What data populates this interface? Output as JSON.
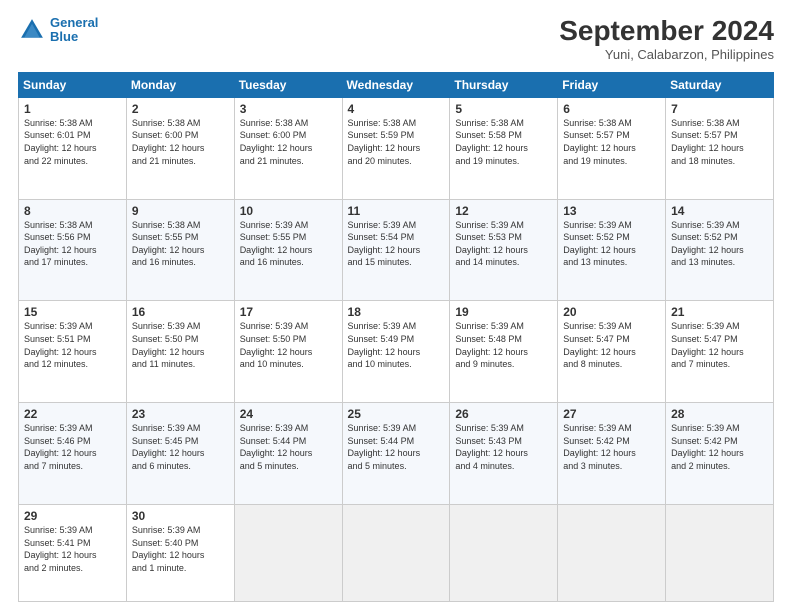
{
  "logo": {
    "line1": "General",
    "line2": "Blue"
  },
  "title": "September 2024",
  "subtitle": "Yuni, Calabarzon, Philippines",
  "header_days": [
    "Sunday",
    "Monday",
    "Tuesday",
    "Wednesday",
    "Thursday",
    "Friday",
    "Saturday"
  ],
  "weeks": [
    [
      {
        "day": "1",
        "info": "Sunrise: 5:38 AM\nSunset: 6:01 PM\nDaylight: 12 hours\nand 22 minutes."
      },
      {
        "day": "2",
        "info": "Sunrise: 5:38 AM\nSunset: 6:00 PM\nDaylight: 12 hours\nand 21 minutes."
      },
      {
        "day": "3",
        "info": "Sunrise: 5:38 AM\nSunset: 6:00 PM\nDaylight: 12 hours\nand 21 minutes."
      },
      {
        "day": "4",
        "info": "Sunrise: 5:38 AM\nSunset: 5:59 PM\nDaylight: 12 hours\nand 20 minutes."
      },
      {
        "day": "5",
        "info": "Sunrise: 5:38 AM\nSunset: 5:58 PM\nDaylight: 12 hours\nand 19 minutes."
      },
      {
        "day": "6",
        "info": "Sunrise: 5:38 AM\nSunset: 5:57 PM\nDaylight: 12 hours\nand 19 minutes."
      },
      {
        "day": "7",
        "info": "Sunrise: 5:38 AM\nSunset: 5:57 PM\nDaylight: 12 hours\nand 18 minutes."
      }
    ],
    [
      {
        "day": "8",
        "info": "Sunrise: 5:38 AM\nSunset: 5:56 PM\nDaylight: 12 hours\nand 17 minutes."
      },
      {
        "day": "9",
        "info": "Sunrise: 5:38 AM\nSunset: 5:55 PM\nDaylight: 12 hours\nand 16 minutes."
      },
      {
        "day": "10",
        "info": "Sunrise: 5:39 AM\nSunset: 5:55 PM\nDaylight: 12 hours\nand 16 minutes."
      },
      {
        "day": "11",
        "info": "Sunrise: 5:39 AM\nSunset: 5:54 PM\nDaylight: 12 hours\nand 15 minutes."
      },
      {
        "day": "12",
        "info": "Sunrise: 5:39 AM\nSunset: 5:53 PM\nDaylight: 12 hours\nand 14 minutes."
      },
      {
        "day": "13",
        "info": "Sunrise: 5:39 AM\nSunset: 5:52 PM\nDaylight: 12 hours\nand 13 minutes."
      },
      {
        "day": "14",
        "info": "Sunrise: 5:39 AM\nSunset: 5:52 PM\nDaylight: 12 hours\nand 13 minutes."
      }
    ],
    [
      {
        "day": "15",
        "info": "Sunrise: 5:39 AM\nSunset: 5:51 PM\nDaylight: 12 hours\nand 12 minutes."
      },
      {
        "day": "16",
        "info": "Sunrise: 5:39 AM\nSunset: 5:50 PM\nDaylight: 12 hours\nand 11 minutes."
      },
      {
        "day": "17",
        "info": "Sunrise: 5:39 AM\nSunset: 5:50 PM\nDaylight: 12 hours\nand 10 minutes."
      },
      {
        "day": "18",
        "info": "Sunrise: 5:39 AM\nSunset: 5:49 PM\nDaylight: 12 hours\nand 10 minutes."
      },
      {
        "day": "19",
        "info": "Sunrise: 5:39 AM\nSunset: 5:48 PM\nDaylight: 12 hours\nand 9 minutes."
      },
      {
        "day": "20",
        "info": "Sunrise: 5:39 AM\nSunset: 5:47 PM\nDaylight: 12 hours\nand 8 minutes."
      },
      {
        "day": "21",
        "info": "Sunrise: 5:39 AM\nSunset: 5:47 PM\nDaylight: 12 hours\nand 7 minutes."
      }
    ],
    [
      {
        "day": "22",
        "info": "Sunrise: 5:39 AM\nSunset: 5:46 PM\nDaylight: 12 hours\nand 7 minutes."
      },
      {
        "day": "23",
        "info": "Sunrise: 5:39 AM\nSunset: 5:45 PM\nDaylight: 12 hours\nand 6 minutes."
      },
      {
        "day": "24",
        "info": "Sunrise: 5:39 AM\nSunset: 5:44 PM\nDaylight: 12 hours\nand 5 minutes."
      },
      {
        "day": "25",
        "info": "Sunrise: 5:39 AM\nSunset: 5:44 PM\nDaylight: 12 hours\nand 5 minutes."
      },
      {
        "day": "26",
        "info": "Sunrise: 5:39 AM\nSunset: 5:43 PM\nDaylight: 12 hours\nand 4 minutes."
      },
      {
        "day": "27",
        "info": "Sunrise: 5:39 AM\nSunset: 5:42 PM\nDaylight: 12 hours\nand 3 minutes."
      },
      {
        "day": "28",
        "info": "Sunrise: 5:39 AM\nSunset: 5:42 PM\nDaylight: 12 hours\nand 2 minutes."
      }
    ],
    [
      {
        "day": "29",
        "info": "Sunrise: 5:39 AM\nSunset: 5:41 PM\nDaylight: 12 hours\nand 2 minutes."
      },
      {
        "day": "30",
        "info": "Sunrise: 5:39 AM\nSunset: 5:40 PM\nDaylight: 12 hours\nand 1 minute."
      },
      {
        "day": "",
        "info": ""
      },
      {
        "day": "",
        "info": ""
      },
      {
        "day": "",
        "info": ""
      },
      {
        "day": "",
        "info": ""
      },
      {
        "day": "",
        "info": ""
      }
    ]
  ]
}
